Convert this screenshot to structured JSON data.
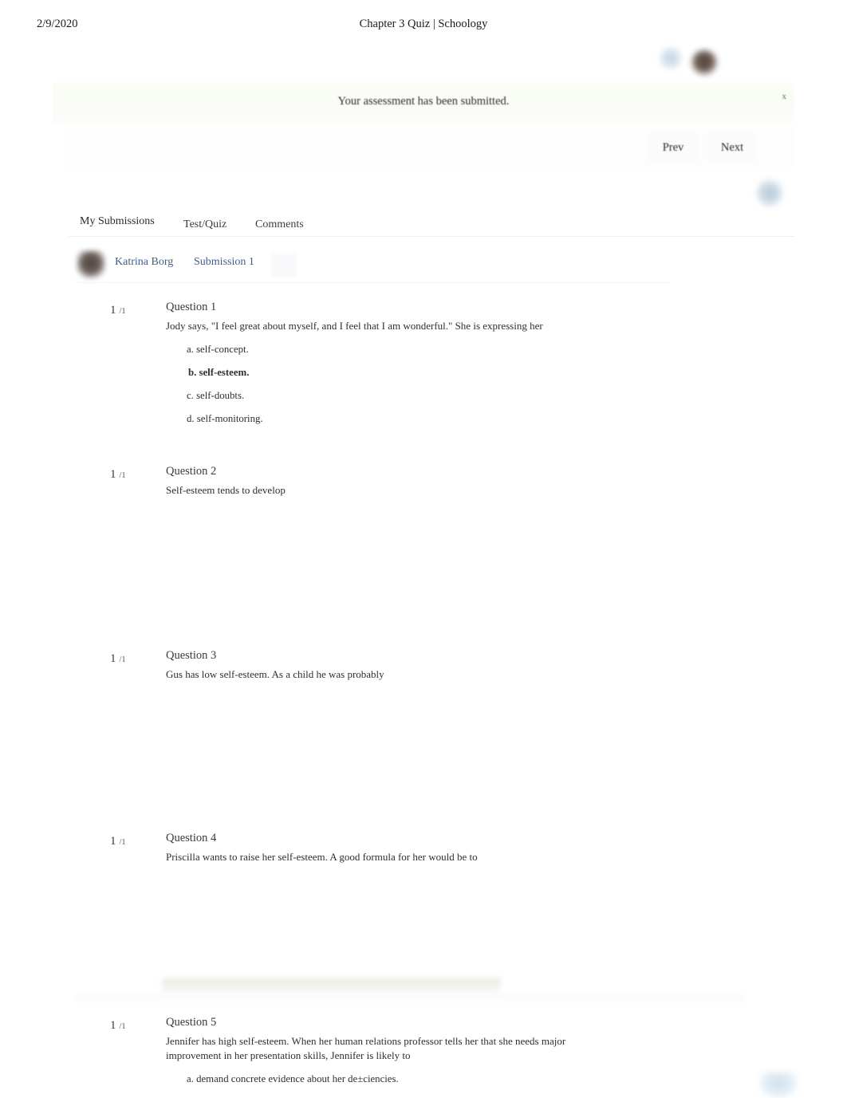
{
  "print_header": {
    "date": "2/9/2020",
    "title": "Chapter 3 Quiz | Schoology"
  },
  "banner": {
    "message": "Your assessment has been submitted.",
    "close_label": "x"
  },
  "navigation": {
    "prev_label": "Prev",
    "next_label": "Next"
  },
  "tabs": [
    {
      "label": "My Submissions",
      "active": true
    },
    {
      "label": "Test/Quiz",
      "active": false
    },
    {
      "label": "Comments",
      "active": false
    }
  ],
  "submission": {
    "student_name": "Katrina Borg",
    "attempt_label": "Submission 1"
  },
  "questions": [
    {
      "score": "1",
      "out_of": "/1",
      "title": "Question 1",
      "text": "Jody says, \"I feel great about myself, and I feel that I am wonderful.\" She is expressing her",
      "options": [
        {
          "label": "a. self-concept.",
          "selected": false
        },
        {
          "label": "b. self-esteem.",
          "selected": true
        },
        {
          "label": "c. self-doubts.",
          "selected": false
        },
        {
          "label": "d. self-monitoring.",
          "selected": false
        }
      ]
    },
    {
      "score": "1",
      "out_of": "/1",
      "title": "Question 2",
      "text": "Self-esteem tends to develop",
      "options": []
    },
    {
      "score": "1",
      "out_of": "/1",
      "title": "Question 3",
      "text": "Gus has low self-esteem. As a child he was probably",
      "options": []
    },
    {
      "score": "1",
      "out_of": "/1",
      "title": "Question 4",
      "text": "Priscilla wants to raise her self-esteem. A good formula for her would be to",
      "options": []
    },
    {
      "score": "1",
      "out_of": "/1",
      "title": "Question 5",
      "text": "Jennifer has high self-esteem. When her human relations professor tells her that she needs major improvement in her presentation skills, Jennifer is likely to",
      "options": [
        {
          "label": "a. demand concrete evidence about her de±ciencies.",
          "selected": false
        }
      ]
    }
  ],
  "colors": {
    "link": "#3e5f8a",
    "correct_highlight": "#e7efe0",
    "text": "#2f2f2f"
  }
}
